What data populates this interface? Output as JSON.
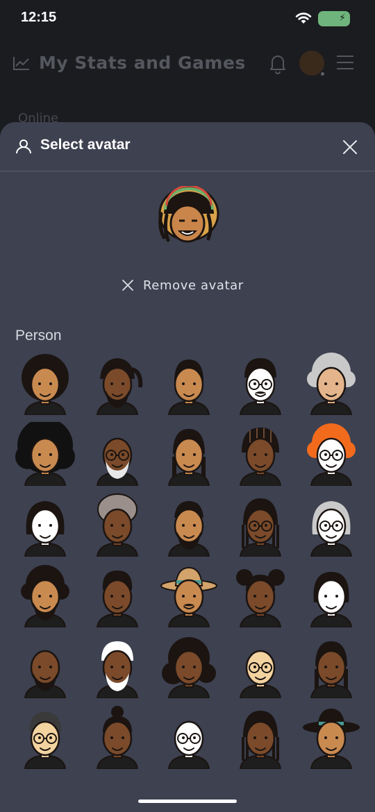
{
  "status": {
    "time": "12:15"
  },
  "app": {
    "title": "My Stats and Games",
    "online_label": "Online"
  },
  "sheet": {
    "title": "Select avatar",
    "remove_label": "Remove avatar",
    "section_label": "Person"
  },
  "avatars": [
    {
      "skin": "#c98a50",
      "hair": "#1b1411",
      "style": "afro",
      "shirt": "#1e1e1e"
    },
    {
      "skin": "#7a4a2a",
      "hair": "#1b1411",
      "style": "locs",
      "shirt": "#1e1e1e",
      "beard": true
    },
    {
      "skin": "#c98a50",
      "hair": "#1b1411",
      "style": "braid",
      "shirt": "#1e1e1e"
    },
    {
      "skin": "#ffffff",
      "hair": "#1b1411",
      "style": "short",
      "shirt": "#1e1e1e",
      "glasses": true,
      "mustache": true
    },
    {
      "skin": "#e4b58c",
      "hair": "#c9c9c9",
      "style": "curly",
      "shirt": "#1e1e1e"
    },
    {
      "skin": "#c98a50",
      "hair": "#111111",
      "style": "bigafro",
      "shirt": "#1e1e1e"
    },
    {
      "skin": "#7a4a2a",
      "hair": "#e8e8e8",
      "style": "bald",
      "shirt": "#1e1e1e",
      "glasses": true,
      "beard": true,
      "beardColor": "#e8e8e8"
    },
    {
      "skin": "#c98a50",
      "hair": "#1b1411",
      "style": "braids2",
      "shirt": "#1e1e1e"
    },
    {
      "skin": "#7a4a2a",
      "hair": "#1b1411",
      "style": "cornrows",
      "shirt": "#1e1e1e"
    },
    {
      "skin": "#ffffff",
      "hair": "#f26b1d",
      "style": "curly",
      "shirt": "#1e1e1e",
      "glasses": true
    },
    {
      "skin": "#ffffff",
      "hair": "#1b1411",
      "style": "bob",
      "shirt": "#1e1e1e"
    },
    {
      "skin": "#7a4a2a",
      "hair": "#9a8f8a",
      "style": "wrap",
      "shirt": "#1e1e1e"
    },
    {
      "skin": "#c98a50",
      "hair": "#1b1411",
      "style": "fade",
      "shirt": "#1e1e1e",
      "beard": true
    },
    {
      "skin": "#7a4a2a",
      "hair": "#1b1411",
      "style": "longbraids",
      "shirt": "#1e1e1e",
      "glasses": true
    },
    {
      "skin": "#ffffff",
      "hair": "#c9c9c9",
      "style": "bob",
      "shirt": "#1e1e1e",
      "glasses": true
    },
    {
      "skin": "#c98a50",
      "hair": "#1b1411",
      "style": "curly",
      "shirt": "#1e1e1e",
      "beard": true
    },
    {
      "skin": "#7a4a2a",
      "hair": "#1b1411",
      "style": "curlytop",
      "shirt": "#1e1e1e"
    },
    {
      "skin": "#c98a50",
      "hair": "#d2a36a",
      "style": "hat",
      "shirt": "#1e1e1e",
      "mustache": true
    },
    {
      "skin": "#7a4a2a",
      "hair": "#1b1411",
      "style": "puffs",
      "shirt": "#1e1e1e"
    },
    {
      "skin": "#ffffff",
      "hair": "#1b1411",
      "style": "bangs",
      "shirt": "#1e1e1e"
    },
    {
      "skin": "#7a4a2a",
      "hair": "#1b1411",
      "style": "bald",
      "shirt": "#1e1e1e",
      "beard": true
    },
    {
      "skin": "#7a4a2a",
      "hair": "#ffffff",
      "style": "short",
      "shirt": "#1e1e1e",
      "beard": true,
      "beardColor": "#ffffff"
    },
    {
      "skin": "#7a4a2a",
      "hair": "#1b1411",
      "style": "longcurly",
      "shirt": "#1e1e1e"
    },
    {
      "skin": "#f3d3a0",
      "hair": "#c9c9c9",
      "style": "bald",
      "shirt": "#1e1e1e",
      "glasses": true
    },
    {
      "skin": "#7a4a2a",
      "hair": "#1b1411",
      "style": "braids2",
      "shirt": "#1e1e1e"
    },
    {
      "skin": "#f3d3a0",
      "hair": "#3a3a3a",
      "style": "short",
      "shirt": "#1e1e1e",
      "glasses": true
    },
    {
      "skin": "#7a4a2a",
      "hair": "#1b1411",
      "style": "bun",
      "shirt": "#1e1e1e"
    },
    {
      "skin": "#ffffff",
      "hair": "#d0d0d0",
      "style": "bald",
      "shirt": "#1e1e1e",
      "glasses": true
    },
    {
      "skin": "#7a4a2a",
      "hair": "#1b1411",
      "style": "longbraids",
      "shirt": "#1e1e1e"
    },
    {
      "skin": "#c98a50",
      "hair": "#1b1411",
      "style": "hat",
      "shirt": "#1e1e1e"
    }
  ],
  "colors": {
    "sheet_bg": "#3d4150",
    "app_bg": "#1b1c20",
    "battery": "#6fb47c"
  }
}
